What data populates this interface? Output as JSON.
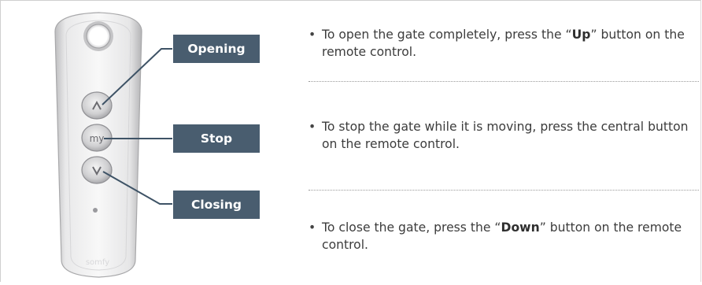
{
  "labels": {
    "opening": "Opening",
    "stop": "Stop",
    "closing": "Closing"
  },
  "remote": {
    "center_button_text": "my",
    "brand_text": "somfy"
  },
  "instructions": {
    "open": {
      "before": "To open the gate completely, press the “",
      "key": "Up",
      "after": "” button on the remote control."
    },
    "stop": {
      "text": "To stop the gate while it is moving, press the central button on the remote control."
    },
    "close": {
      "before": "To close the gate, press the “",
      "key": "Down",
      "after": "” button on the remote control."
    }
  },
  "colors": {
    "label_bg": "#495d6f",
    "label_text": "#ffffff",
    "body_text": "#3c3c3c"
  }
}
